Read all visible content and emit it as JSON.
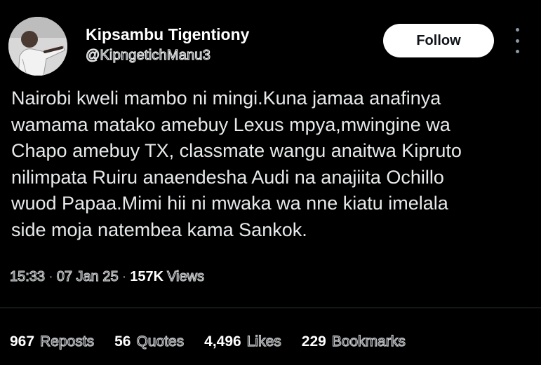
{
  "author": {
    "display_name": "Kipsambu Tigentiony",
    "handle": "@KipngetichManu3",
    "avatar_icon": "profile-photo"
  },
  "follow_label": "Follow",
  "more_icon": "more-options-icon",
  "tweet": {
    "text": "Nairobi kweli mambo ni mingi.Kuna jamaa anafinya\nwamama matako amebuy Lexus mpya,mwingine wa\nChapo amebuy TX, classmate wangu anaitwa Kipruto\nnilimpata Ruiru anaendesha Audi na anajiita Ochillo\nwuod Papaa.Mimi hii ni mwaka wa nne kiatu imelala\nside moja natembea kama Sankok."
  },
  "meta": {
    "time": "15:33",
    "separator": "·",
    "date": "07 Jan 25",
    "views_count": "157K",
    "views_label": "Views"
  },
  "stats": {
    "reposts_count": "967",
    "reposts_label": "Reposts",
    "quotes_count": "56",
    "quotes_label": "Quotes",
    "likes_count": "4,496",
    "likes_label": "Likes",
    "bookmarks_count": "229",
    "bookmarks_label": "Bookmarks"
  },
  "colors": {
    "background": "#000000",
    "text": "#e7e9ea",
    "secondary": "#8b98a5",
    "divider": "#2f3336",
    "button_bg": "#ffffff"
  }
}
